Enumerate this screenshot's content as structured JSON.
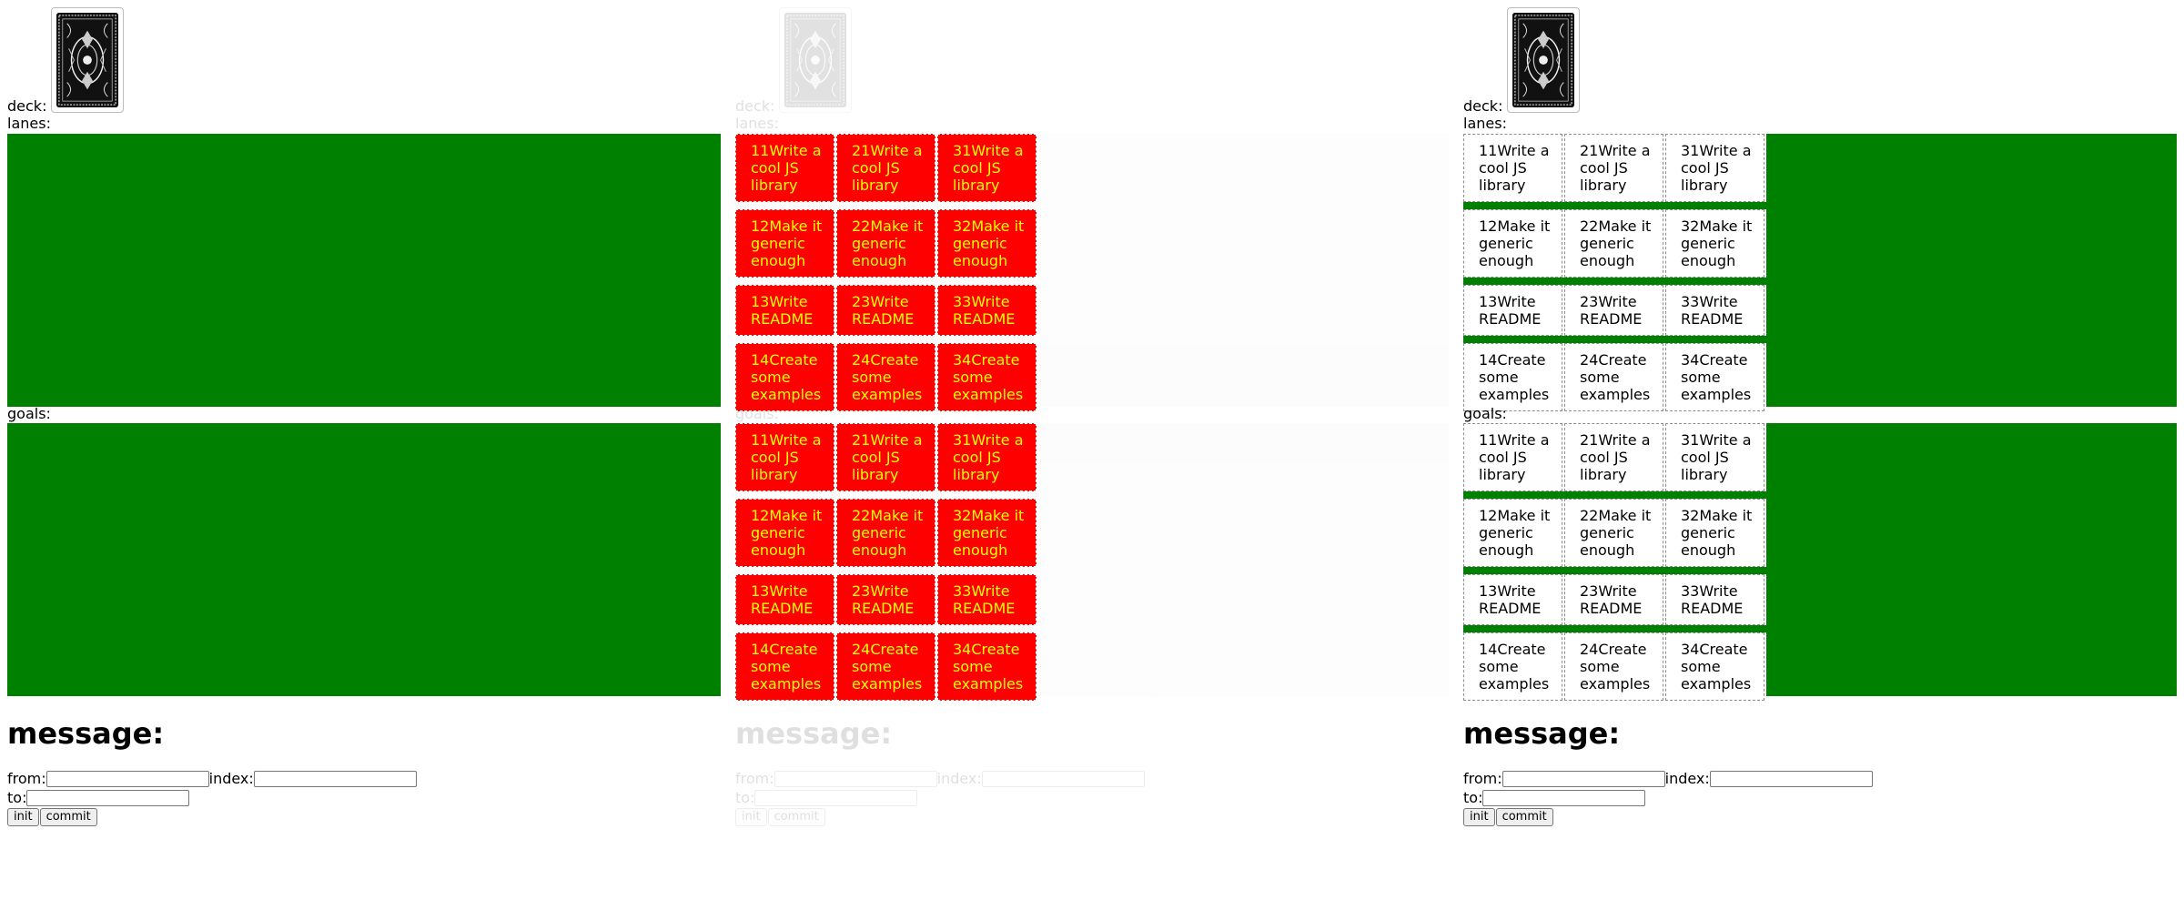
{
  "labels": {
    "deck": "deck:",
    "lanes": "lanes:",
    "goals": "goals:",
    "message": "message:",
    "from": "from:",
    "index": "index:",
    "to": "to:"
  },
  "buttons": {
    "init": "init",
    "commit": "commit"
  },
  "inputs": {
    "from": "",
    "index": "",
    "to": ""
  },
  "colors": {
    "area_green": "#008000",
    "area_grey": "#ececec",
    "card_red": "#ff0000",
    "card_red_text": "#ffff00"
  },
  "icons": {
    "deck": "card-back-icon"
  },
  "panels": [
    "left",
    "middle",
    "right"
  ],
  "rows": [
    {
      "cards": [
        {
          "num": "11",
          "title": "Write a cool JS library"
        },
        {
          "num": "21",
          "title": "Write a cool JS library"
        },
        {
          "num": "31",
          "title": "Write a cool JS library"
        }
      ]
    },
    {
      "cards": [
        {
          "num": "12",
          "title": "Make it generic enough"
        },
        {
          "num": "22",
          "title": "Make it generic enough"
        },
        {
          "num": "32",
          "title": "Make it generic enough"
        }
      ]
    },
    {
      "cards": [
        {
          "num": "13",
          "title": "Write README"
        },
        {
          "num": "23",
          "title": "Write README"
        },
        {
          "num": "33",
          "title": "Write README"
        }
      ]
    },
    {
      "cards": [
        {
          "num": "14",
          "title": "Create some examples"
        },
        {
          "num": "24",
          "title": "Create some examples"
        },
        {
          "num": "34",
          "title": "Create some examples"
        }
      ]
    }
  ]
}
